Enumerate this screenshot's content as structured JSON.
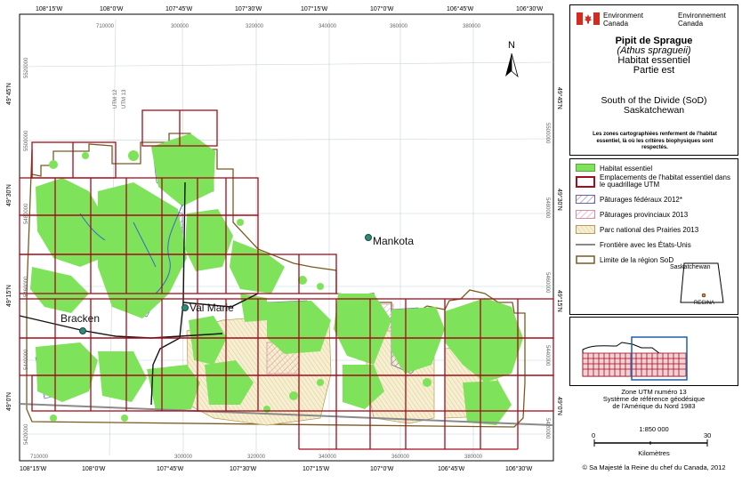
{
  "header": {
    "dept_en": "Environment",
    "dept_en2": "Canada",
    "dept_fr": "Environnement",
    "dept_fr2": "Canada",
    "colors": {
      "flag_red": "#d52b1e"
    }
  },
  "title": {
    "line1": "Pipit de Sprague",
    "line2": "(Athus spragueii)",
    "line3": "Habitat essentiel",
    "line4": "Partie est",
    "region1": "South of the Divide (SoD)",
    "region2": "Saskatchewan",
    "note": "Les zones cartographiées renferment de l'habitat essentiel, là où les critères biophysiques sont respectés."
  },
  "legend": {
    "items": [
      {
        "label": "Habitat essentiel",
        "color": "#7ee35a"
      },
      {
        "label": "Emplacements de l'habitat essentiel dans le quadrillage UTM",
        "color": "#a30d1d"
      },
      {
        "label": "Pâturages fédéraux 2012*",
        "color": "#6a5fa8"
      },
      {
        "label": "Pâturages provinciaux 2013",
        "color": "#d88ca6"
      },
      {
        "label": "Parc national des Prairies 2013",
        "color": "#f4ecc6"
      },
      {
        "label": "Frontière avec les États-Unis",
        "color": "#8a8a8a"
      },
      {
        "label": "Limite de la région SoD",
        "color": "#7a5a22"
      }
    ]
  },
  "inset": {
    "province_label": "Saskatchewan",
    "city_label": "REGINA"
  },
  "projection": {
    "line1": "Zone UTM numéro 13",
    "line2": "Système de référence géodésique",
    "line3": "de l'Amérique du Nord 1983",
    "scale": "1:850 000",
    "scale_min": "0",
    "scale_max": "30",
    "scale_unit": "Kilomètres"
  },
  "copyright": "© Sa Majesté la Reine du chef du Canada, 2012",
  "map": {
    "north": "N",
    "towns": {
      "mankota": "Mankota",
      "val_marie": "Val Marie",
      "bracken": "Bracken"
    },
    "lon_top": [
      "108°15'W",
      "108°0'W",
      "107°45'W",
      "107°30'W",
      "107°15'W",
      "107°0'W",
      "106°45'W",
      "106°30'W"
    ],
    "lon_bottom": [
      "108°15'W",
      "108°0'W",
      "107°45'W",
      "107°30'W",
      "107°15'W",
      "107°0'W",
      "106°45'W",
      "106°30'W"
    ],
    "easting_top": [
      "710000",
      "300000",
      "320000",
      "340000",
      "360000",
      "380000"
    ],
    "easting_bottom": [
      "710000",
      "300000",
      "320000",
      "340000",
      "360000",
      "380000"
    ],
    "lat_left": [
      "49°45'N",
      "49°30'N",
      "49°15'N",
      "49°0'N"
    ],
    "lat_right": [
      "49°45'N",
      "49°30'N",
      "49°15'N",
      "49°0'N"
    ],
    "northing_left": [
      "5520000",
      "5500000",
      "5480000",
      "5460000",
      "5440000",
      "5420000"
    ],
    "northing_right": [
      "5500000",
      "5480000",
      "5460000",
      "5440000",
      "5420000"
    ],
    "utm12": "UTM 12",
    "utm13": "UTM 13"
  }
}
